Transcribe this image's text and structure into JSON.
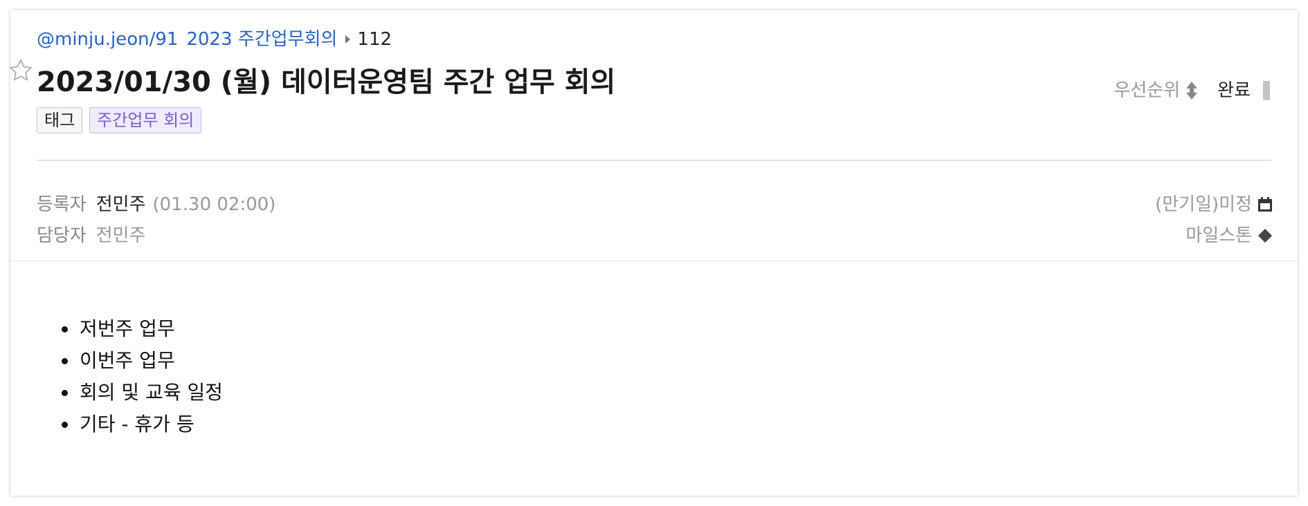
{
  "breadcrumb": {
    "project": "@minju.jeon/91",
    "path": "2023 주간업무회의",
    "number": "112"
  },
  "title": "2023/01/30 (월) 데이터운영팀 주간 업무 회의",
  "tags": [
    "태그",
    "주간업무 회의"
  ],
  "controls": {
    "priority_label": "우선순위",
    "status_label": "완료"
  },
  "meta": {
    "registrant_label": "등록자",
    "registrant_name": "전민주",
    "registrant_time": "(01.30 02:00)",
    "assignee_label": "담당자",
    "assignee_name": "전민주",
    "due_label": "(만기일)미정",
    "milestone_label": "마일스톤"
  },
  "body_items": [
    "저번주 업무",
    "이번주 업무",
    "회의 및 교육 일정",
    "기타 - 휴가 등"
  ],
  "colors": {
    "link": "#2563c9",
    "tag_purple": "#7a5fcf"
  },
  "icons": [
    "star-icon",
    "breadcrumb-arrow-icon",
    "priority-sort-icon",
    "status-bar-icon",
    "calendar-icon",
    "milestone-diamond-icon"
  ]
}
